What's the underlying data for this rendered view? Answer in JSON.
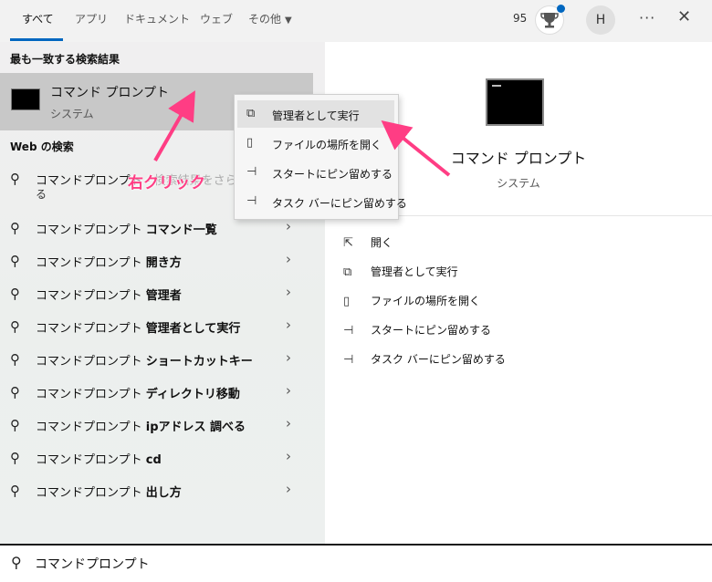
{
  "tabs": [
    {
      "label": "すべて",
      "active": true
    },
    {
      "label": "アプリ"
    },
    {
      "label": "ドキュメント"
    },
    {
      "label": "ウェブ"
    },
    {
      "label": "その他"
    }
  ],
  "header": {
    "points": "95",
    "avatar_initial": "H",
    "more": "···",
    "close": "✕"
  },
  "best_match": {
    "section": "最も一致する検索結果",
    "title": "コマンド プロンプト",
    "subtitle": "システム"
  },
  "web": {
    "section": "Web の検索",
    "first": {
      "prefix": "コマンドプロンプト",
      "suffix": "- 検索結果をさらに表示",
      "line2": "る"
    },
    "items": [
      {
        "prefix": "コマンドプロンプト",
        "bold": "コマンド一覧"
      },
      {
        "prefix": "コマンドプロンプト",
        "bold": "開き方"
      },
      {
        "prefix": "コマンドプロンプト",
        "bold": "管理者"
      },
      {
        "prefix": "コマンドプロンプト",
        "bold": "管理者として実行"
      },
      {
        "prefix": "コマンドプロンプト",
        "bold": "ショートカットキー"
      },
      {
        "prefix": "コマンドプロンプト",
        "bold": "ディレクトリ移動"
      },
      {
        "prefix": "コマンドプロンプト",
        "bold": "ipアドレス 調べる"
      },
      {
        "prefix": "コマンドプロンプト",
        "bold": "cd"
      },
      {
        "prefix": "コマンドプロンプト",
        "bold": "出し方"
      }
    ]
  },
  "context_menu": [
    {
      "label": "管理者として実行",
      "icon": "shield-run-icon",
      "glyph": "⧉"
    },
    {
      "label": "ファイルの場所を開く",
      "icon": "file-location-icon",
      "glyph": "▯"
    },
    {
      "label": "スタートにピン留めする",
      "icon": "pin-icon",
      "glyph": "⊣"
    },
    {
      "label": "タスク バーにピン留めする",
      "icon": "pin-icon",
      "glyph": "⊣"
    }
  ],
  "annotation": "右クリック",
  "detail": {
    "title": "コマンド プロンプト",
    "subtitle": "システム",
    "actions": [
      {
        "label": "開く",
        "icon": "open-icon",
        "glyph": "⇱"
      },
      {
        "label": "管理者として実行",
        "icon": "shield-run-icon",
        "glyph": "⧉"
      },
      {
        "label": "ファイルの場所を開く",
        "icon": "file-location-icon",
        "glyph": "▯"
      },
      {
        "label": "スタートにピン留めする",
        "icon": "pin-icon",
        "glyph": "⊣"
      },
      {
        "label": "タスク バーにピン留めする",
        "icon": "pin-icon",
        "glyph": "⊣"
      }
    ]
  },
  "search": {
    "value": "コマンドプロンプト",
    "icon": "search-icon"
  },
  "colors": {
    "accent": "#0067c0",
    "annotation": "#ff3d84"
  }
}
